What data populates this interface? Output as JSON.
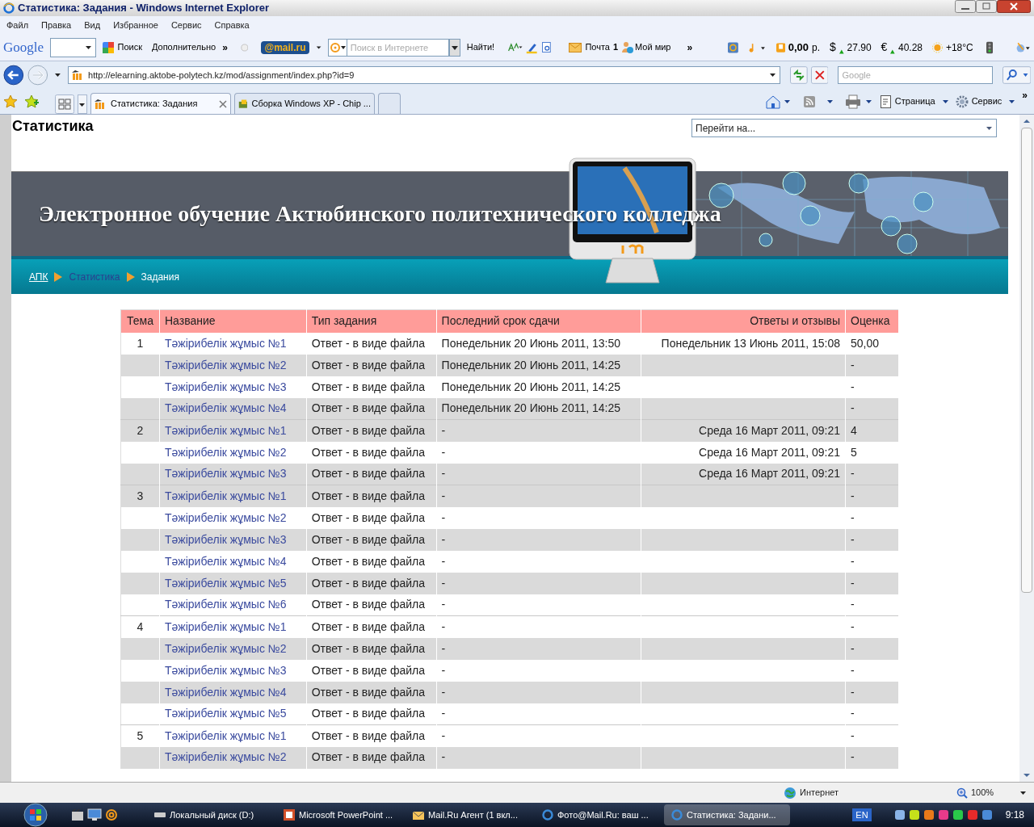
{
  "window": {
    "title": "Статистика: Задания - Windows Internet Explorer"
  },
  "menu": [
    "Файл",
    "Правка",
    "Вид",
    "Избранное",
    "Сервис",
    "Справка"
  ],
  "toolbar": {
    "google_logo": "Google",
    "search_button": "Поиск",
    "more": "Дополнительно",
    "more_chevron": "»",
    "mail_logo": "@mail.ru",
    "web_search": {
      "placeholder": "Поиск в Интернете"
    },
    "find_button": "Найти!",
    "mail_label": "Почта",
    "mail_count": "1",
    "my_world": "Мой мир",
    "chevron": "»",
    "balance": "0,00",
    "balance_unit": "р.",
    "usd_sign": "$",
    "usd": "27.90",
    "eur_sign": "€",
    "eur": "40.28",
    "weather": "+18°C"
  },
  "address_bar": {
    "url": "http://elearning.aktobe-polytech.kz/mod/assignment/index.php?id=9",
    "search_placeholder": "Google"
  },
  "tabs": [
    {
      "label": "Статистика: Задания",
      "selected": true
    },
    {
      "label": "Сборка Windows XP - Chip ...",
      "selected": false
    }
  ],
  "command_bar": {
    "page": "Страница",
    "tools": "Сервис",
    "chevron": "»"
  },
  "page": {
    "heading": "Статистика",
    "jump_menu": "Перейти на...",
    "banner_title": "Электронное обучение Актюбинского политехнического колледжа",
    "breadcrumbs": [
      {
        "label": "АПК",
        "kind": "link"
      },
      {
        "label": "Статистика",
        "kind": "link"
      },
      {
        "label": "Задания",
        "kind": "current"
      }
    ],
    "table": {
      "columns": [
        "Тема",
        "Название",
        "Тип задания",
        "Последний срок сдачи",
        "Ответы и отзывы",
        "Оценка"
      ],
      "sections": [
        {
          "topic": "1",
          "rows": [
            {
              "name": "Тәжірибелік жұмыс №1",
              "type": "Ответ - в виде файла",
              "deadline": "Понедельник 20 Июнь 2011, 13:50",
              "submissions": "Понедельник 13 Июнь 2011, 15:08",
              "grade": "50,00",
              "shaded": false
            },
            {
              "name": "Тәжірибелік жұмыс №2",
              "type": "Ответ - в виде файла",
              "deadline": "Понедельник 20 Июнь 2011, 14:25",
              "submissions": "",
              "grade": "-",
              "shaded": true
            },
            {
              "name": "Тәжірибелік жұмыс №3",
              "type": "Ответ - в виде файла",
              "deadline": "Понедельник 20 Июнь 2011, 14:25",
              "submissions": "",
              "grade": "-",
              "shaded": false
            },
            {
              "name": "Тәжірибелік жұмыс №4",
              "type": "Ответ - в виде файла",
              "deadline": "Понедельник 20 Июнь 2011, 14:25",
              "submissions": "",
              "grade": "-",
              "shaded": true
            }
          ]
        },
        {
          "topic": "2",
          "rows": [
            {
              "name": "Тәжірибелік жұмыс №1",
              "type": "Ответ - в виде файла",
              "deadline": "-",
              "submissions": "Среда 16 Март 2011, 09:21",
              "grade": "4",
              "shaded": true
            },
            {
              "name": "Тәжірибелік жұмыс №2",
              "type": "Ответ - в виде файла",
              "deadline": "-",
              "submissions": "Среда 16 Март 2011, 09:21",
              "grade": "5",
              "shaded": false
            },
            {
              "name": "Тәжірибелік жұмыс №3",
              "type": "Ответ - в виде файла",
              "deadline": "-",
              "submissions": "Среда 16 Март 2011, 09:21",
              "grade": "-",
              "shaded": true
            }
          ]
        },
        {
          "topic": "3",
          "rows": [
            {
              "name": "Тәжірибелік жұмыс №1",
              "type": "Ответ - в виде файла",
              "deadline": "-",
              "submissions": "",
              "grade": "-",
              "shaded": true
            },
            {
              "name": "Тәжірибелік жұмыс №2",
              "type": "Ответ - в виде файла",
              "deadline": "-",
              "submissions": "",
              "grade": "-",
              "shaded": false
            },
            {
              "name": "Тәжірибелік жұмыс №3",
              "type": "Ответ - в виде файла",
              "deadline": "-",
              "submissions": "",
              "grade": "-",
              "shaded": true
            },
            {
              "name": "Тәжірибелік жұмыс №4",
              "type": "Ответ - в виде файла",
              "deadline": "-",
              "submissions": "",
              "grade": "-",
              "shaded": false
            },
            {
              "name": "Тәжірибелік жұмыс №5",
              "type": "Ответ - в виде файла",
              "deadline": "-",
              "submissions": "",
              "grade": "-",
              "shaded": true
            },
            {
              "name": "Тәжірибелік жұмыс №6",
              "type": "Ответ - в виде файла",
              "deadline": "-",
              "submissions": "",
              "grade": "-",
              "shaded": false
            }
          ]
        },
        {
          "topic": "4",
          "rows": [
            {
              "name": "Тәжірибелік жұмыс №1",
              "type": "Ответ - в виде файла",
              "deadline": "-",
              "submissions": "",
              "grade": "-",
              "shaded": false
            },
            {
              "name": "Тәжірибелік жұмыс №2",
              "type": "Ответ - в виде файла",
              "deadline": "-",
              "submissions": "",
              "grade": "-",
              "shaded": true
            },
            {
              "name": "Тәжірибелік жұмыс №3",
              "type": "Ответ - в виде файла",
              "deadline": "-",
              "submissions": "",
              "grade": "-",
              "shaded": false
            },
            {
              "name": "Тәжірибелік жұмыс №4",
              "type": "Ответ - в виде файла",
              "deadline": "-",
              "submissions": "",
              "grade": "-",
              "shaded": true
            },
            {
              "name": "Тәжірибелік жұмыс №5",
              "type": "Ответ - в виде файла",
              "deadline": "-",
              "submissions": "",
              "grade": "-",
              "shaded": false
            }
          ]
        },
        {
          "topic": "5",
          "rows": [
            {
              "name": "Тәжірибелік жұмыс №1",
              "type": "Ответ - в виде файла",
              "deadline": "-",
              "submissions": "",
              "grade": "-",
              "shaded": false
            },
            {
              "name": "Тәжірибелік жұмыс №2",
              "type": "Ответ - в виде файла",
              "deadline": "-",
              "submissions": "",
              "grade": "-",
              "shaded": true
            }
          ]
        }
      ]
    }
  },
  "status_bar": {
    "zone": "Интернет",
    "zoom": "100%"
  },
  "taskbar": {
    "buttons": [
      {
        "label": "Локальный диск (D:)",
        "selected": false
      },
      {
        "label": "Microsoft PowerPoint ...",
        "selected": false
      },
      {
        "label": "Mail.Ru Агент (1 вкл...",
        "selected": false
      },
      {
        "label": "Фото@Mail.Ru: ваш ...",
        "selected": false
      },
      {
        "label": "Статистика: Задани...",
        "selected": true
      }
    ],
    "language": "EN",
    "clock": "9:18"
  }
}
